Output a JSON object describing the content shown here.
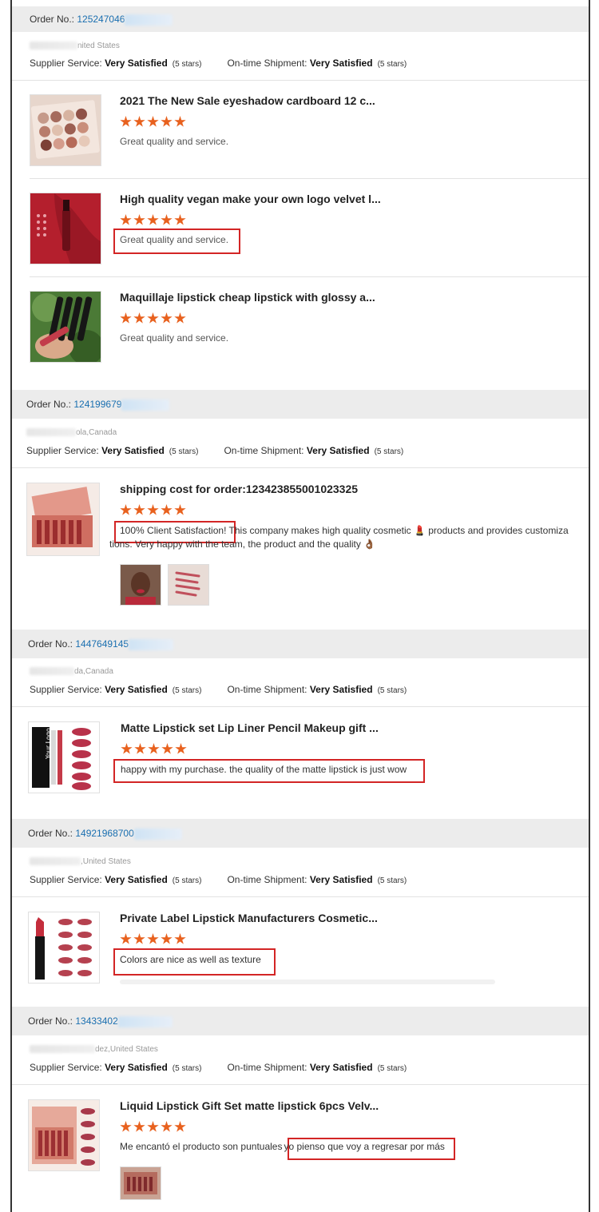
{
  "common": {
    "order_label": "Order No.:",
    "supplier_label": "Supplier Service:",
    "shipment_label": "On-time Shipment:",
    "rating_value": "Very Satisfied",
    "rating_stars": "(5 stars)"
  },
  "orders": [
    {
      "order_no": "125247046",
      "location": "nited States",
      "items": [
        {
          "title": "2021 The New Sale eyeshadow cardboard 12 c...",
          "review": "Great quality and service.",
          "stars": 5
        },
        {
          "title": "High quality vegan make your own logo velvet l...",
          "review": "Great quality and service.",
          "stars": 5
        },
        {
          "title": "Maquillaje lipstick cheap lipstick with glossy a...",
          "review": "Great quality and service.",
          "stars": 5
        }
      ]
    },
    {
      "order_no": "124199679",
      "location": "ola,Canada",
      "items": [
        {
          "title": "shipping cost for order:123423855001023325",
          "review_highlight": "100% Client Satisfaction!",
          "review_line1": " This company makes high quality cosmetic 💄 products and provides customiza",
          "review_line2": "tions. Very happy with the team, the product and the quality 👌🏾",
          "stars": 5
        }
      ]
    },
    {
      "order_no": "1447649145",
      "location": "da,Canada",
      "items": [
        {
          "title": "Matte Lipstick set Lip Liner Pencil Makeup gift ...",
          "review": "happy with my purchase. the quality of the matte lipstick is just wow",
          "stars": 5
        }
      ]
    },
    {
      "order_no": "14921968700",
      "location": ",United States",
      "items": [
        {
          "title": "Private Label Lipstick Manufacturers Cosmetic...",
          "review": "Colors are nice as well as texture",
          "stars": 5
        }
      ]
    },
    {
      "order_no": "13433402",
      "location": "dez,United States",
      "items": [
        {
          "title": "Liquid Lipstick Gift Set matte lipstick 6pcs Velv...",
          "review_plain": "Me encantó el producto son puntuales",
          "review_highlight": "yo pienso que voy a regresar por más",
          "stars": 5
        }
      ]
    }
  ],
  "thumb_text": {
    "your_logo": "Your Logo"
  },
  "colors": {
    "star": "#e8611e",
    "order_link": "#1a6fb0",
    "highlight": "#d32525",
    "bar": "#ececec"
  }
}
